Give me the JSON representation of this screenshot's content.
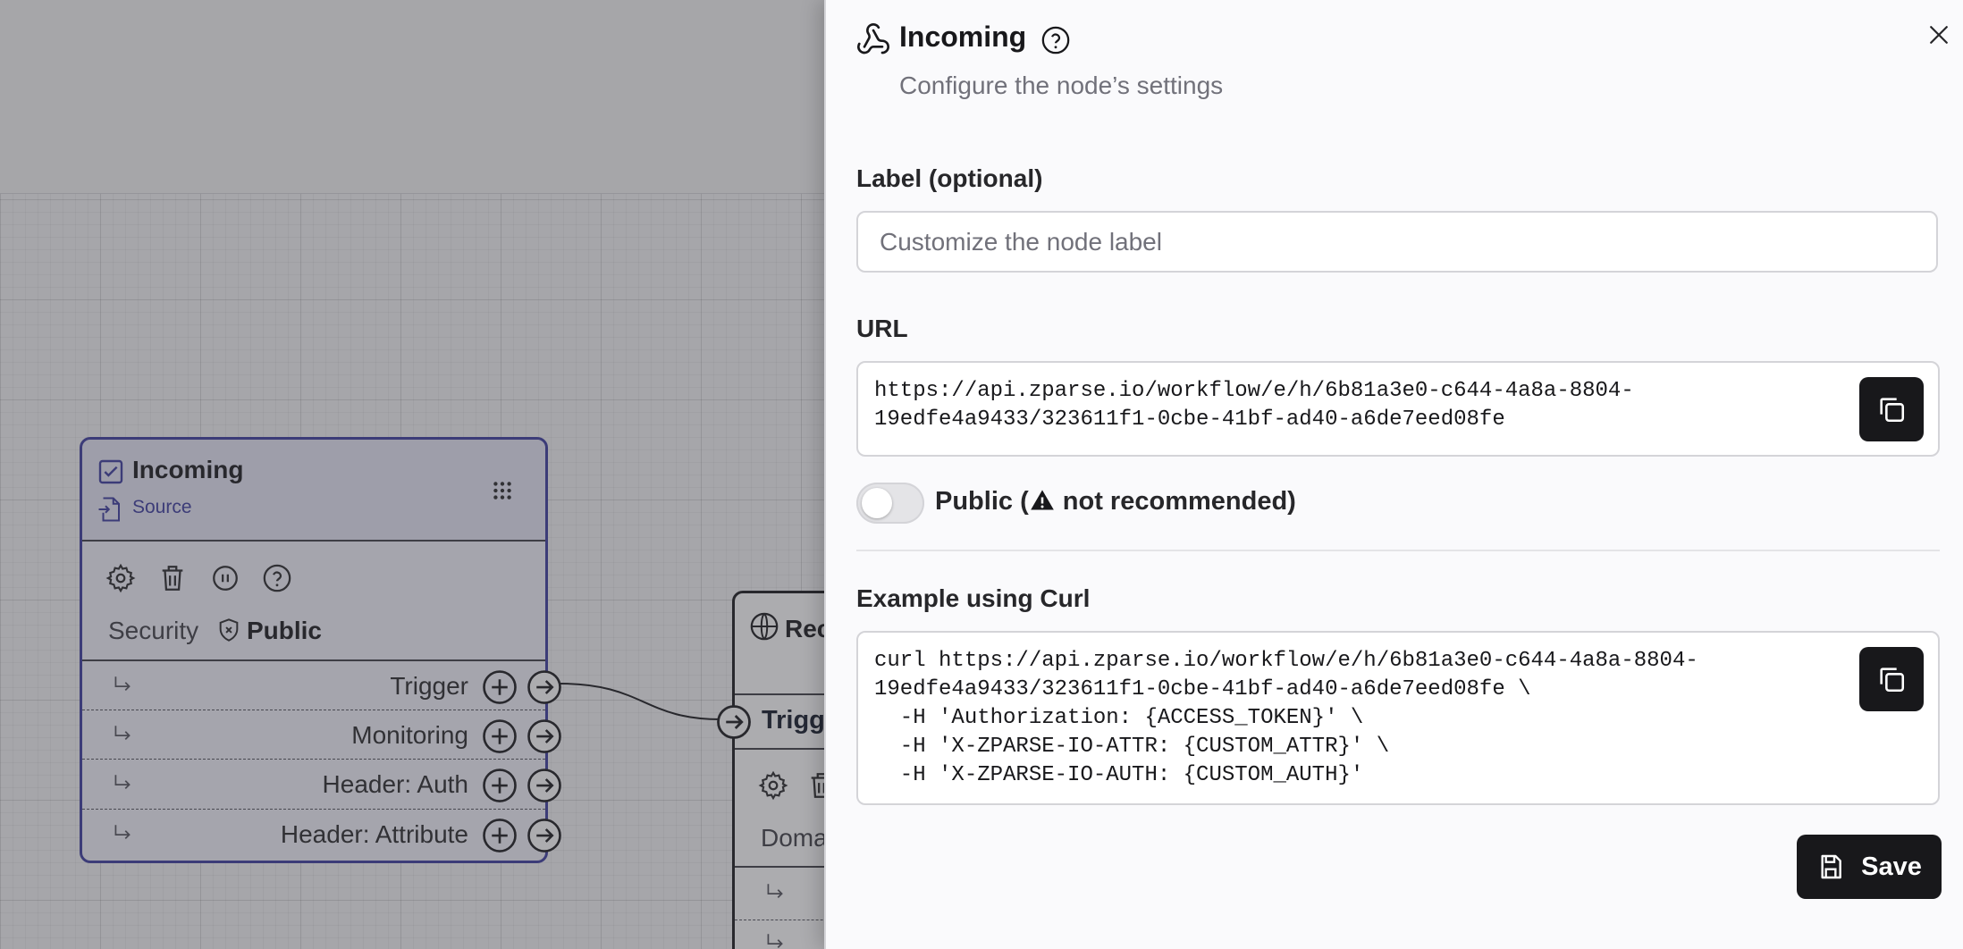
{
  "canvas": {
    "incoming_node": {
      "title": "Incoming",
      "subtitle": "Source",
      "security_label": "Security",
      "security_value": "Public",
      "handles": [
        {
          "label": "Trigger"
        },
        {
          "label": "Monitoring"
        },
        {
          "label": "Header: Auth"
        },
        {
          "label": "Header: Attribute"
        }
      ]
    },
    "receiver_node": {
      "title_partial": "Rec",
      "handle_partial": "Trigge",
      "field_partial": "Doma"
    }
  },
  "panel": {
    "title": "Incoming",
    "subtitle": "Configure the node’s settings",
    "label_field": {
      "label": "Label (optional)",
      "placeholder": "Customize the node label",
      "value": ""
    },
    "url_field": {
      "label": "URL",
      "value_lines": [
        "https://api.zparse.io/workflow/e/h/6b81a3e0-c644-4a8a-8804-",
        "19edfe4a9433/323611f1-0cbe-41bf-ad40-a6de7eed08fe"
      ]
    },
    "public_toggle": {
      "label_prefix": "Public (",
      "label_suffix": " not recommended)",
      "checked": false
    },
    "curl_example": {
      "label": "Example using Curl",
      "lines": [
        "curl https://api.zparse.io/workflow/e/h/6b81a3e0-c644-4a8a-8804-",
        "19edfe4a9433/323611f1-0cbe-41bf-ad40-a6de7eed08fe \\",
        "  -H 'Authorization: {ACCESS_TOKEN}' \\",
        "  -H 'X-ZPARSE-IO-ATTR: {CUSTOM_ATTR}' \\",
        "  -H 'X-ZPARSE-IO-AUTH: {CUSTOM_AUTH}'"
      ]
    },
    "save_label": "Save"
  },
  "colors": {
    "node_accent": "#3b3a9e",
    "button_dark": "#18181b",
    "muted_text": "#71717a"
  },
  "icons": [
    "checkbox-icon",
    "source-file-icon",
    "drag-grid-icon",
    "gear-icon",
    "trash-icon",
    "pause-icon",
    "help-icon",
    "shield-icon",
    "corner-arrow-icon",
    "plus-circle-icon",
    "arrow-right-circle-icon",
    "webhook-icon",
    "close-icon",
    "copy-icon",
    "warning-icon",
    "save-icon",
    "globe-icon"
  ]
}
